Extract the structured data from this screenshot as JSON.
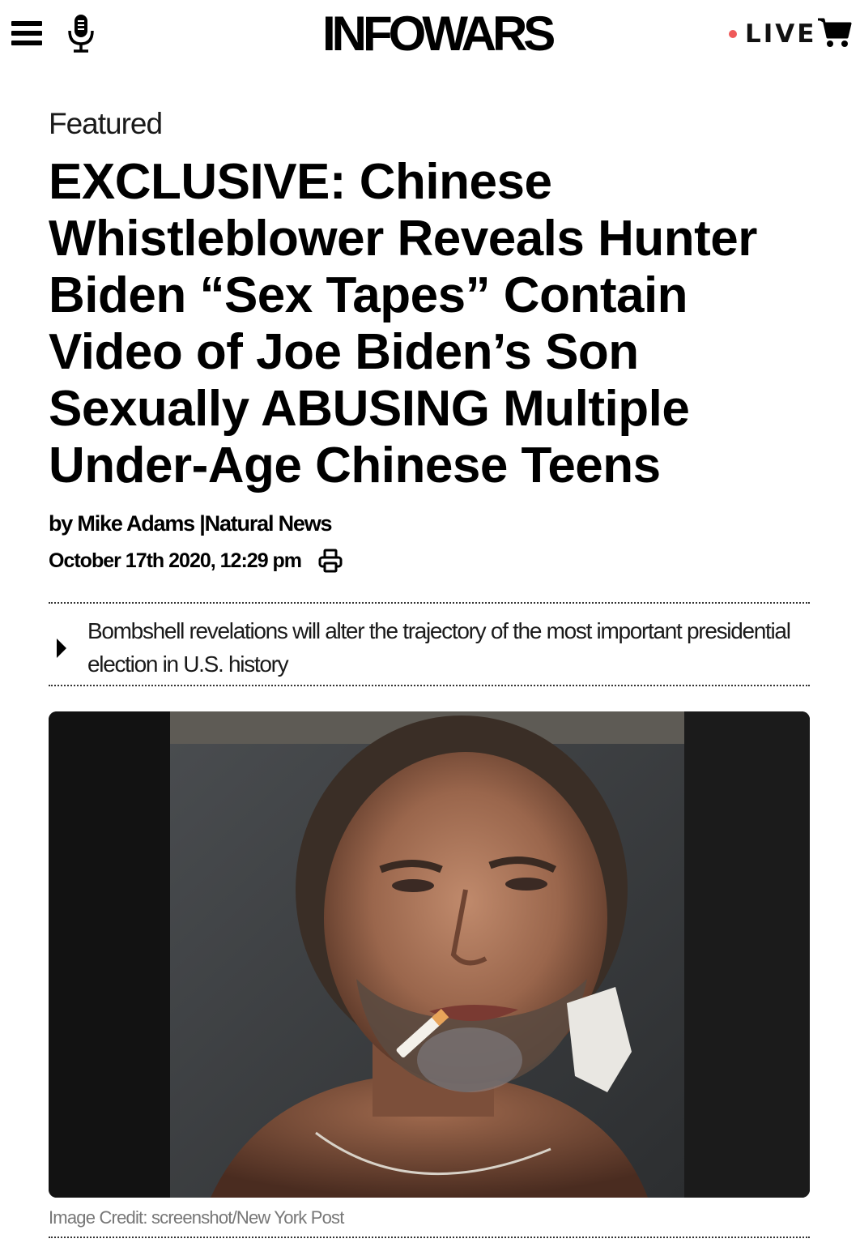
{
  "header": {
    "logo": "INFOWARS",
    "live_label": "LIVE",
    "icons": {
      "menu": "hamburger-menu-icon",
      "mic": "microphone-icon",
      "cart": "shopping-cart-icon",
      "live_dot_color": "#ef5a5a"
    }
  },
  "article": {
    "category": "Featured",
    "title": "EXCLUSIVE: Chinese Whistleblower Reveals Hunter Biden “Sex Tapes” Contain Video of Joe Biden’s Son Sexually ABUSING Multiple Under-Age Chinese Teens",
    "author_prefix": "by",
    "author": "Mike Adams",
    "separator": "|",
    "source": "Natural News",
    "date": "October 17th 2020, 12:29 pm",
    "summary": "Bombshell revelations will alter the trajectory of the most important presidential election in U.S. history",
    "image_credit_label": "Image Credit:",
    "image_credit": "screenshot/New York Post"
  }
}
